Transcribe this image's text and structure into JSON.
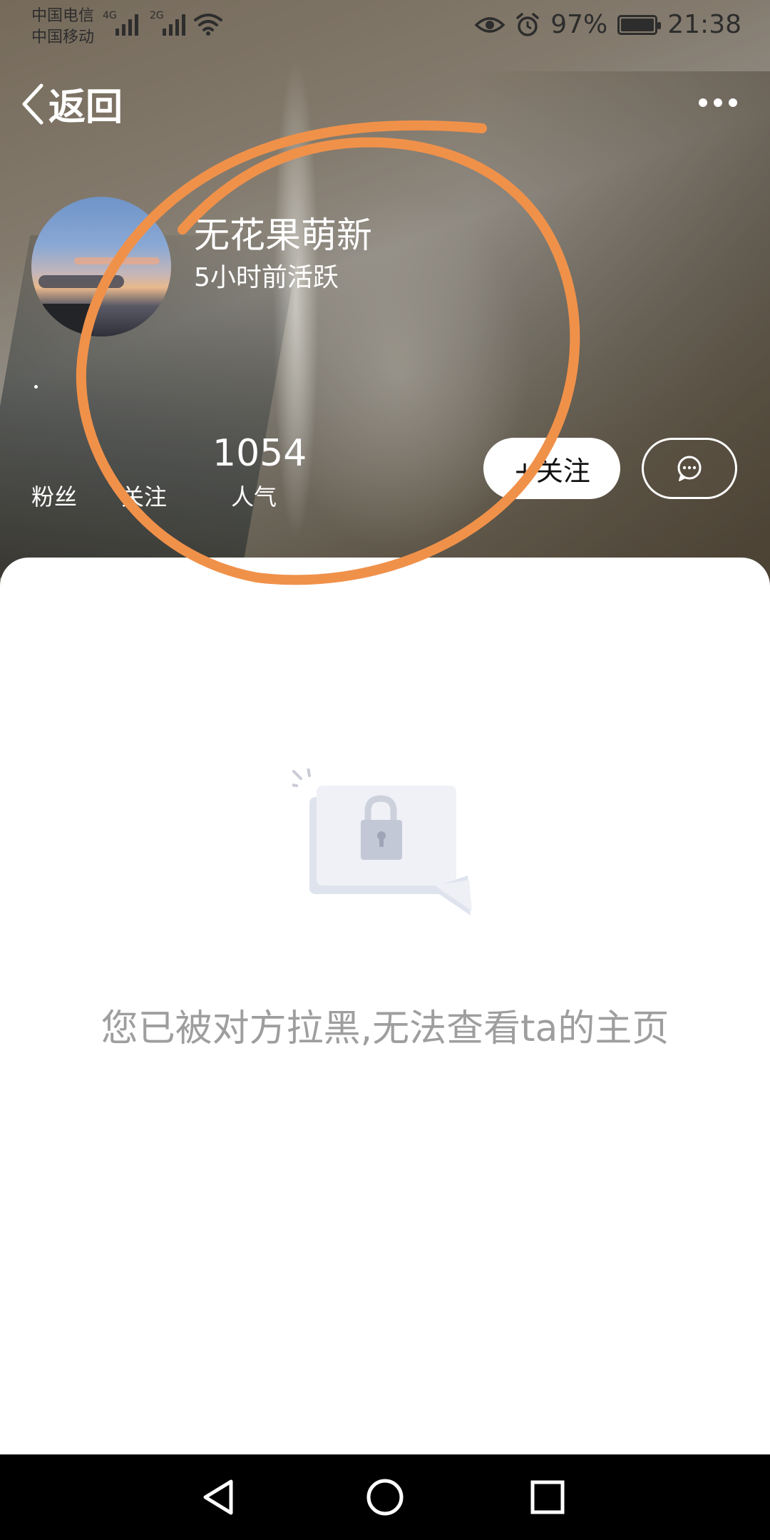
{
  "status_bar": {
    "carrier_1": "中国电信",
    "carrier_2": "中国移动",
    "network_1": "4G",
    "network_2": "2G",
    "battery_percent": "97%",
    "time": "21:38",
    "icons": [
      "signal-icon",
      "wifi-icon",
      "eye-icon",
      "alarm-icon",
      "battery-icon"
    ]
  },
  "nav": {
    "back_label": "返回",
    "more_icon": "more-dots-icon"
  },
  "profile": {
    "username": "无花果萌新",
    "activity": "5小时前活跃",
    "dot": "·"
  },
  "stats": {
    "fans_label": "粉丝",
    "following_label": "关注",
    "popularity_value": "1054",
    "popularity_label": "人气"
  },
  "actions": {
    "follow_label": "+关注",
    "message_icon": "chat-bubble-icon"
  },
  "content": {
    "blocked_message": "您已被对方拉黑,无法查看ta的主页",
    "illustration_icon": "lock-icon"
  },
  "annotation": {
    "color": "#F0914A"
  },
  "navbar": {
    "icons": [
      "back-triangle-icon",
      "home-circle-icon",
      "recents-square-icon"
    ]
  }
}
